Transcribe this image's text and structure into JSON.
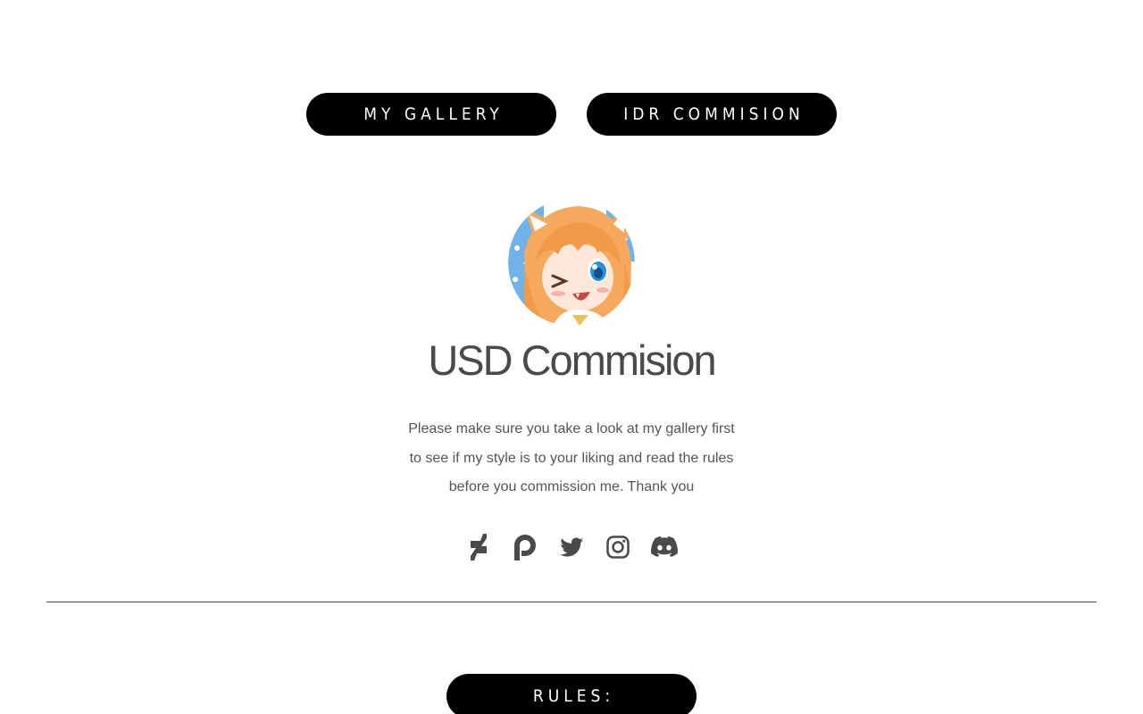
{
  "nav": {
    "gallery_label": "MY GALLERY",
    "idr_label": "IDR COMMISION"
  },
  "profile": {
    "avatar": "anime-fox-girl-avatar",
    "title": "USD Commision",
    "description_lines": [
      "Please make sure you take a look at my gallery first",
      "to see if my style is to your liking and read the rules",
      "before you commission me. Thank you"
    ]
  },
  "socials": [
    {
      "icon": "deviantart-icon"
    },
    {
      "icon": "patreon-icon"
    },
    {
      "icon": "twitter-icon"
    },
    {
      "icon": "instagram-icon"
    },
    {
      "icon": "discord-icon"
    }
  ],
  "rules": {
    "label": "RULES:"
  },
  "colors": {
    "button_bg": "#000000",
    "button_text": "#ffffff",
    "title_text": "#4a4a4a",
    "body_text": "#555555",
    "icon": "#4a4a4a"
  }
}
